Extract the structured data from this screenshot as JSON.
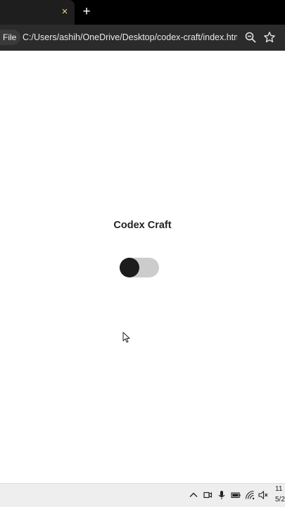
{
  "browser": {
    "tab": {
      "close_glyph": "×"
    },
    "new_tab_glyph": "+",
    "address_bar": {
      "scheme_chip": "File",
      "url": "C:/Users/ashih/OneDrive/Desktop/codex-craft/index.html"
    },
    "icons": {
      "zoom": "zoom-out-icon",
      "bookmark": "star-icon"
    }
  },
  "page": {
    "heading": "Codex Craft",
    "toggle": {
      "state": "off",
      "track_color": "#cccccc",
      "knob_color": "#1c1c1c"
    }
  },
  "taskbar": {
    "clock": {
      "time": "11",
      "date": "5/2"
    },
    "tray_icons": [
      "chevron-up-icon",
      "meet-now-icon",
      "microphone-icon",
      "battery-icon",
      "wifi-icon",
      "speaker-muted-icon"
    ]
  },
  "colors": {
    "tab_close": "#f0d27a",
    "tab_bar": "#000000",
    "toolbar": "#2b2b2b"
  }
}
